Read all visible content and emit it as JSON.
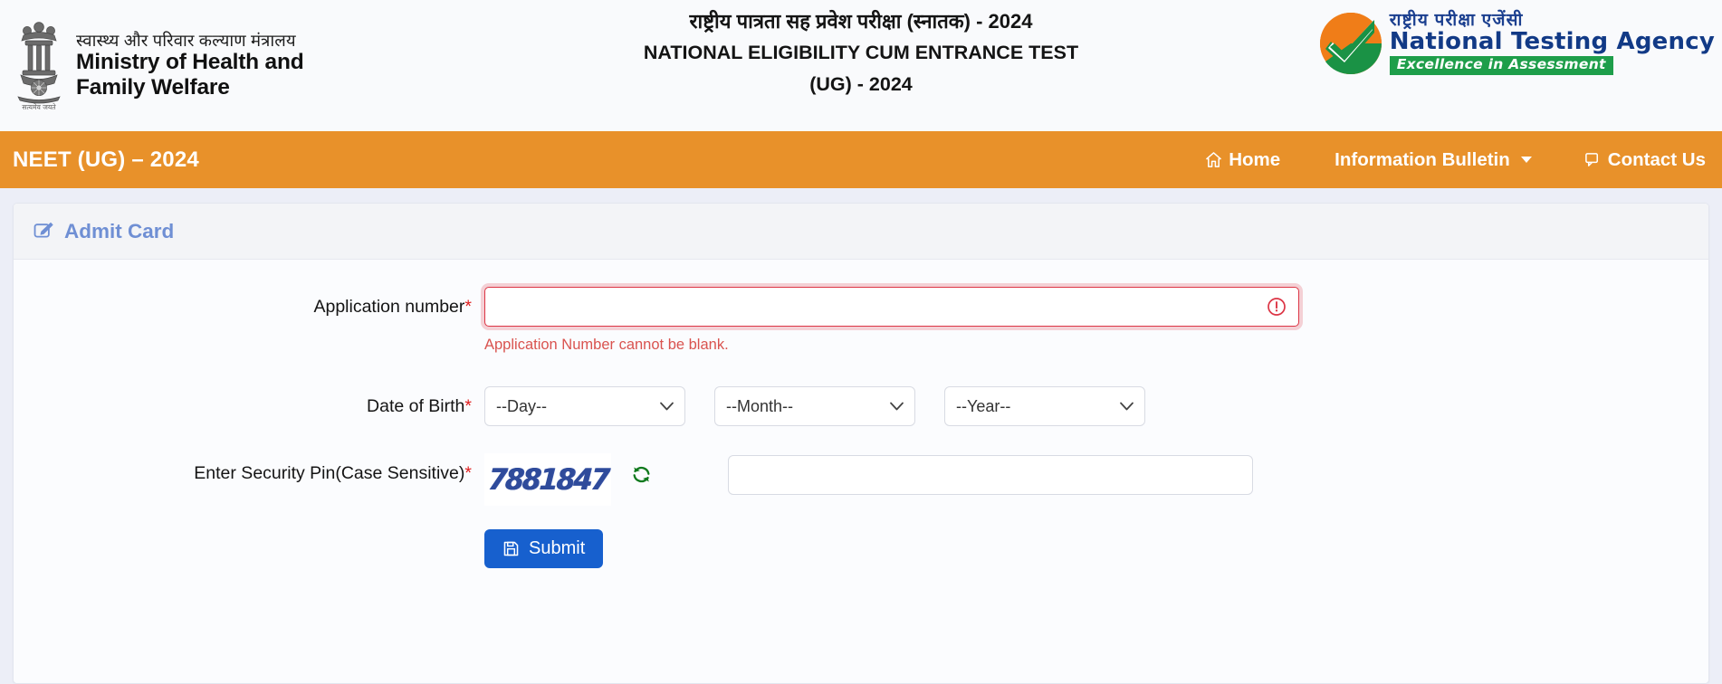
{
  "header": {
    "ministry_hindi": "स्वास्थ्य और परिवार कल्याण मंत्रालय",
    "ministry_line1": "Ministry of Health and",
    "ministry_line2": "Family Welfare",
    "emblem_motto": "सत्यमेव जयते",
    "title_hindi": "राष्ट्रीय पात्रता सह प्रवेश परीक्षा (स्नातक) - 2024",
    "title_english": "NATIONAL ELIGIBILITY CUM ENTRANCE TEST",
    "title_suffix": "(UG) - 2024",
    "nta_hindi": "राष्ट्रीय  परीक्षा  एजेंसी",
    "nta_english": "National Testing Agency",
    "nta_tagline": "Excellence in Assessment"
  },
  "navbar": {
    "brand": "NEET (UG) – 2024",
    "background_color": "#e8912a",
    "items": [
      {
        "label": "Home",
        "icon": "home-icon"
      },
      {
        "label": "Information Bulletin",
        "icon": "chevron-down-icon"
      },
      {
        "label": "Contact Us",
        "icon": "comment-icon"
      }
    ]
  },
  "card": {
    "title": "Admit Card",
    "title_icon": "edit-square-icon",
    "title_color": "#6f8fd4"
  },
  "form": {
    "application_number": {
      "label": "Application number",
      "required_mark": "*",
      "value": "",
      "placeholder": "",
      "error": "Application Number cannot be blank.",
      "error_color": "#d9534f",
      "status_icon": "exclamation-circle-icon"
    },
    "date_of_birth": {
      "label": "Date of Birth",
      "required_mark": "*",
      "day": {
        "selected": "--Day--",
        "options": [
          "--Day--"
        ]
      },
      "month": {
        "selected": "--Month--",
        "options": [
          "--Month--"
        ]
      },
      "year": {
        "selected": "--Year--",
        "options": [
          "--Year--"
        ]
      }
    },
    "security_pin": {
      "label": "Enter Security Pin(Case Sensitive)",
      "required_mark": "*",
      "captcha_text": "7881847",
      "captcha_color": "#2f4b9b",
      "refresh_icon": "refresh-icon",
      "value": "",
      "placeholder": ""
    },
    "submit": {
      "label": "Submit",
      "icon": "save-icon",
      "color": "#1760ce"
    }
  }
}
